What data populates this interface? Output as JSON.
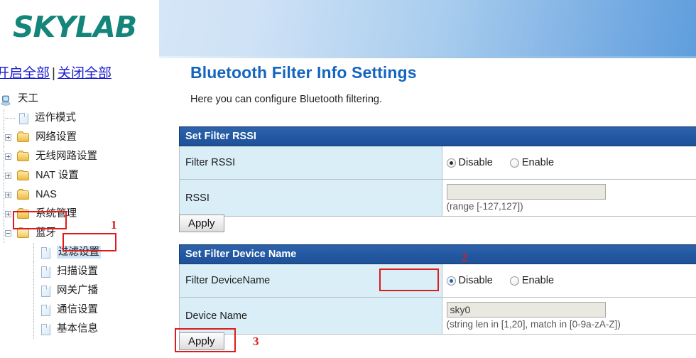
{
  "brand": {
    "logo_text": "SKYLAB"
  },
  "tree_links": {
    "expand_all": "开启全部",
    "separator": "|",
    "collapse_all": "关闭全部"
  },
  "sidebar": {
    "root": {
      "label": "天工",
      "icon": "computer-icon"
    },
    "items": [
      {
        "label": "运作模式",
        "icon": "page-icon",
        "expander": "none",
        "level": 1
      },
      {
        "label": "网络设置",
        "icon": "folder-icon",
        "expander": "plus",
        "level": 1
      },
      {
        "label": "无线网路设置",
        "icon": "folder-icon",
        "expander": "plus",
        "level": 1
      },
      {
        "label": "NAT 设置",
        "icon": "folder-icon",
        "expander": "plus",
        "level": 1
      },
      {
        "label": "NAS",
        "icon": "folder-icon",
        "expander": "plus",
        "level": 1
      },
      {
        "label": "系统管理",
        "icon": "folder-icon",
        "expander": "plus",
        "level": 1
      },
      {
        "label": "蓝牙",
        "icon": "folder-open-icon",
        "expander": "minus",
        "level": 1,
        "highlighted_box": true
      },
      {
        "label": "过滤设置",
        "icon": "page-icon",
        "expander": "none",
        "level": 2,
        "selected": true,
        "highlighted_box": true
      },
      {
        "label": "扫描设置",
        "icon": "page-icon",
        "expander": "none",
        "level": 2
      },
      {
        "label": "网关广播",
        "icon": "page-icon",
        "expander": "none",
        "level": 2
      },
      {
        "label": "通信设置",
        "icon": "page-icon",
        "expander": "none",
        "level": 2
      },
      {
        "label": "基本信息",
        "icon": "page-icon",
        "expander": "none",
        "level": 2
      }
    ]
  },
  "main": {
    "title": "Bluetooth Filter Info Settings",
    "description": "Here you can configure Bluetooth filtering.",
    "sections": [
      {
        "header": "Set Filter RSSI",
        "rows": [
          {
            "label": "Filter RSSI",
            "control": "radio",
            "options": [
              {
                "label": "Disable",
                "selected": true
              },
              {
                "label": "Enable",
                "selected": false
              }
            ]
          },
          {
            "label": "RSSI",
            "control": "text",
            "value": "",
            "hint": "(range [-127,127])"
          }
        ],
        "apply_label": "Apply"
      },
      {
        "header": "Set Filter Device Name",
        "rows": [
          {
            "label": "Filter DeviceName",
            "control": "radio",
            "options": [
              {
                "label": "Disable",
                "selected": true
              },
              {
                "label": "Enable",
                "selected": false
              }
            ]
          },
          {
            "label": "Device Name",
            "control": "text",
            "value": "sky0",
            "hint": "(string len in [1,20], match in [0-9a-zA-Z])"
          }
        ],
        "apply_label": "Apply"
      }
    ]
  },
  "annotations": [
    {
      "number": "1",
      "target": "bluetooth-tree-node"
    },
    {
      "number": "2",
      "target": "filter-devicename-disable-radio"
    },
    {
      "number": "3",
      "target": "device-name-apply-button"
    }
  ],
  "colors": {
    "brand_green": "#14857a",
    "title_blue": "#1565c0",
    "table_header_blue": "#2258a2",
    "label_cell_blue": "#daeef7",
    "annotation_red": "#e01b1b",
    "link_blue": "#1a1ad0"
  }
}
